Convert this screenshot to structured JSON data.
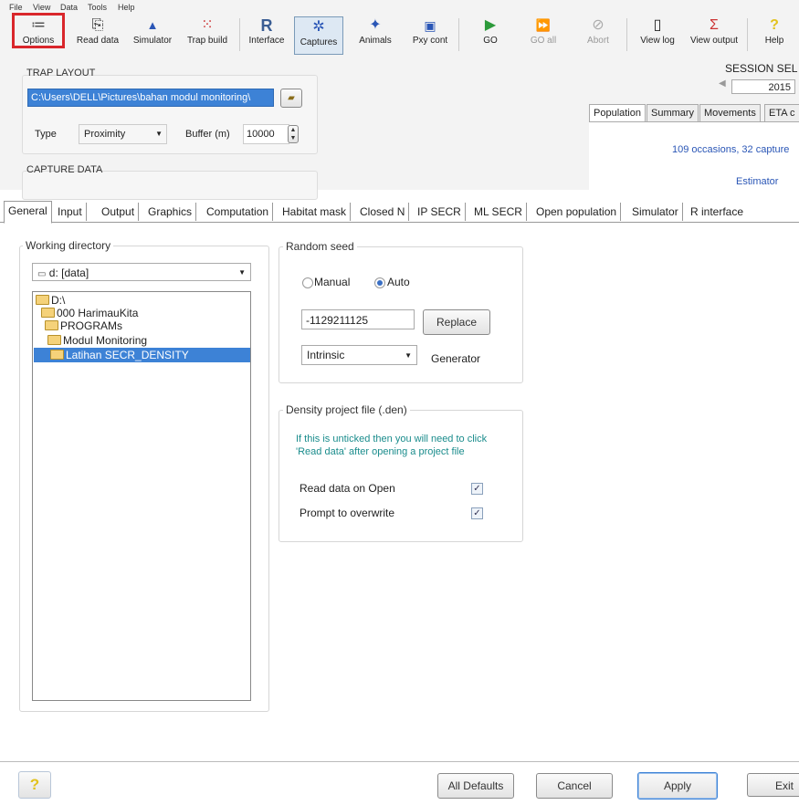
{
  "menu": [
    "File",
    "View",
    "Data",
    "Tools",
    "Help"
  ],
  "toolbar": [
    {
      "label": "Options",
      "icon": "≔",
      "name": "options"
    },
    {
      "label": "Read data",
      "icon": "⎘",
      "name": "read-data"
    },
    {
      "label": "Simulator",
      "icon": "▲",
      "name": "simulator"
    },
    {
      "label": "Trap build",
      "icon": "⁙",
      "name": "trap-build"
    },
    {
      "label": "Interface",
      "icon": "R",
      "name": "interface"
    },
    {
      "label": "Captures",
      "icon": "✲",
      "name": "captures"
    },
    {
      "label": "Animals",
      "icon": "✦",
      "name": "animals"
    },
    {
      "label": "Pxy cont",
      "icon": "▣",
      "name": "pxy-cont"
    },
    {
      "label": "GO",
      "icon": "▶",
      "name": "go"
    },
    {
      "label": "GO all",
      "icon": "⏩",
      "name": "go-all"
    },
    {
      "label": "Abort",
      "icon": "⊘",
      "name": "abort"
    },
    {
      "label": "View log",
      "icon": "▯",
      "name": "view-log"
    },
    {
      "label": "View output",
      "icon": "Σ",
      "name": "view-output"
    },
    {
      "label": "Help",
      "icon": "?",
      "name": "help"
    }
  ],
  "trap_layout": {
    "title": "TRAP LAYOUT",
    "path": "C:\\Users\\DELL\\Pictures\\bahan modul monitoring\\",
    "type_label": "Type",
    "type_value": "Proximity",
    "buffer_label": "Buffer (m)",
    "buffer_value": "10000"
  },
  "capture_data": {
    "title": "CAPTURE DATA"
  },
  "session": {
    "label": "SESSION SEL",
    "value": "2015"
  },
  "results_tabs": [
    "Population",
    "Summary",
    "Movements",
    "ETA c"
  ],
  "results": {
    "occasions": "109 occasions, 32 capture",
    "estimator": "Estimator"
  },
  "settings_tabs": [
    "General",
    "Input",
    "Output",
    "Graphics",
    "Computation",
    "Habitat mask",
    "Closed N",
    "IP SECR",
    "ML SECR",
    "Open population",
    "Simulator",
    "R interface"
  ],
  "working_directory": {
    "title": "Working directory",
    "drive": "d: [data]",
    "tree": [
      "D:\\",
      "000 HarimauKita",
      "PROGRAMs",
      "Modul Monitoring",
      "Latihan SECR_DENSITY"
    ]
  },
  "random_seed": {
    "title": "Random seed",
    "manual_label": "Manual",
    "auto_label": "Auto",
    "seed_value": "-1129211125",
    "replace_label": "Replace",
    "generator_value": "Intrinsic",
    "generator_label": "Generator"
  },
  "density_file": {
    "title": "Density project file (.den)",
    "note": "If this is unticked then  you will need to click 'Read data' after opening a project file",
    "read_on_open_label": "Read data on Open",
    "prompt_label": "Prompt to overwrite"
  },
  "footer": {
    "help_icon": "?",
    "all_defaults": "All Defaults",
    "cancel": "Cancel",
    "apply": "Apply",
    "exit": "Exit"
  },
  "colors": {
    "highlight_red": "#d9262b",
    "selection_blue": "#3d82d6",
    "note_teal": "#1a8c8c",
    "link_blue": "#2a56b6"
  }
}
